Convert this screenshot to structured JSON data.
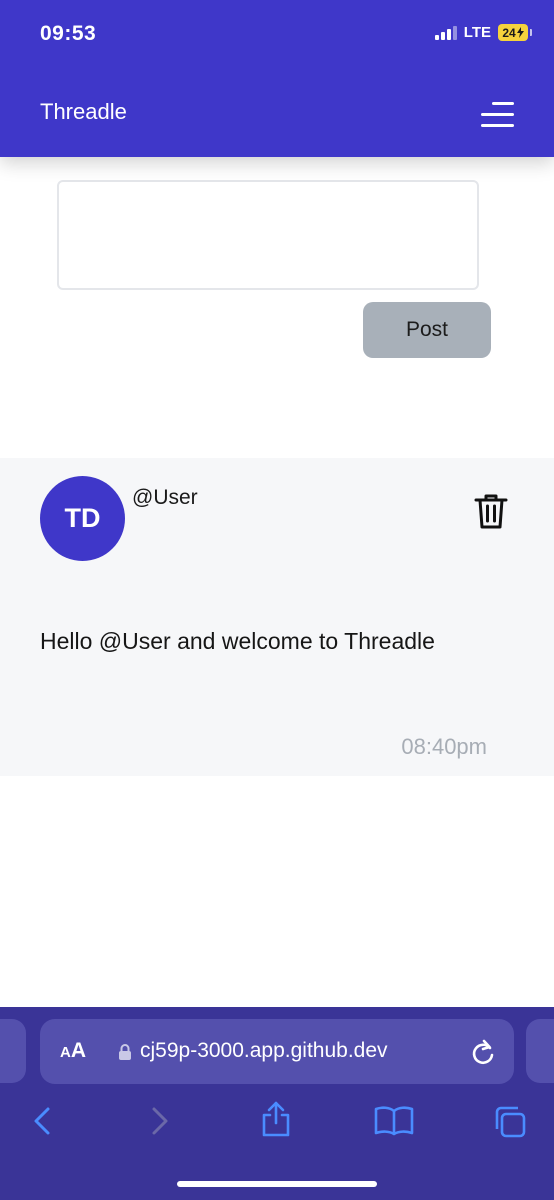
{
  "status_bar": {
    "time": "09:53",
    "network": "LTE",
    "battery": "24"
  },
  "header": {
    "title": "Threadle",
    "menu_icon": "hamburger-menu-icon"
  },
  "composer": {
    "value": "",
    "post_label": "Post"
  },
  "post": {
    "avatar_initials": "TD",
    "username": "@User",
    "body": "Hello @User and welcome to Threadle",
    "time": "08:40pm",
    "delete_icon": "trash-icon"
  },
  "browser": {
    "text_size_small": "A",
    "text_size_big": "A",
    "url": "cj59p-3000.app.github.dev",
    "icons": [
      "lock-icon",
      "reload-icon",
      "back-icon",
      "forward-icon",
      "share-icon",
      "bookmarks-icon",
      "tabs-icon"
    ]
  },
  "colors": {
    "brand": "#3f37c9",
    "browser_bar": "#3a3497",
    "address_pill": "#5450ad",
    "post_button": "#a8b0b9",
    "card_background": "#f6f7f9",
    "timestamp": "#a7adb5",
    "safari_blue": "#4a8cff",
    "battery": "#f5d23c"
  }
}
